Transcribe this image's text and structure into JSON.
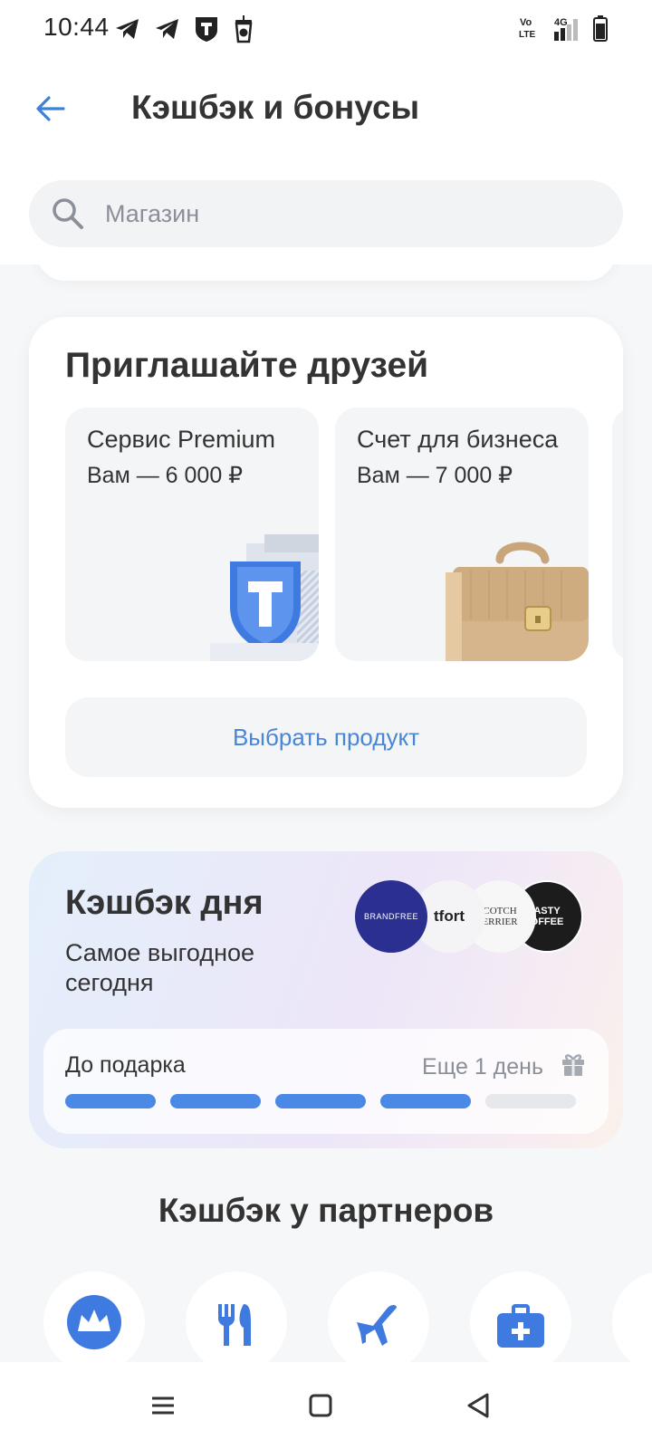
{
  "status_bar": {
    "time": "10:44",
    "left_icons": [
      "telegram-icon",
      "telegram-icon",
      "t-bank-icon",
      "coffee-cup-icon"
    ],
    "right_icons": [
      "volte-icon",
      "signal-4g-icon",
      "battery-icon"
    ],
    "volte_text": "Vo\nLTE",
    "network_text": "4G"
  },
  "header": {
    "title": "Кэшбэк и бонусы",
    "back_icon": "arrow-left-icon"
  },
  "search": {
    "placeholder": "Магазин",
    "value": ""
  },
  "invite": {
    "title": "Приглашайте друзей",
    "offers": [
      {
        "title": "Сервис Premium",
        "reward": "Вам — 6 000 ₽",
        "art": "t-shield-illustration"
      },
      {
        "title": "Счет для бизнеса",
        "reward": "Вам — 7 000 ₽",
        "art": "briefcase-illustration"
      }
    ],
    "button_label": "Выбрать продукт"
  },
  "cashback_day": {
    "title": "Кэшбэк дня",
    "subtitle": "Самое выгодное сегодня",
    "brands": [
      "BRANDFREE",
      "Kitfort",
      "SCOTCH TERRIER",
      "TASTY COFFEE"
    ],
    "brand_texts": {
      "brandfree": "BRANDFREE",
      "kitfort": "tfort",
      "scotch": "COTCH\nERRIER",
      "tasty": "ASTY\nOFFEE"
    },
    "progress_label": "До подарка",
    "progress_remaining": "Еще 1 день",
    "progress_total_steps": 5,
    "progress_completed_steps": 4,
    "colors": {
      "done": "#4a8ae6",
      "todo": "#e6e8ec"
    }
  },
  "partners": {
    "title": "Кэшбэк у партнеров",
    "categories": [
      "crown-icon",
      "food-icon",
      "airplane-icon",
      "medicine-icon"
    ]
  },
  "nav_bar": {
    "buttons": [
      "menu-icon",
      "home-icon",
      "back-icon"
    ]
  },
  "colors": {
    "accent": "#4a86d4",
    "background": "#f6f7f8",
    "card": "#ffffff"
  }
}
